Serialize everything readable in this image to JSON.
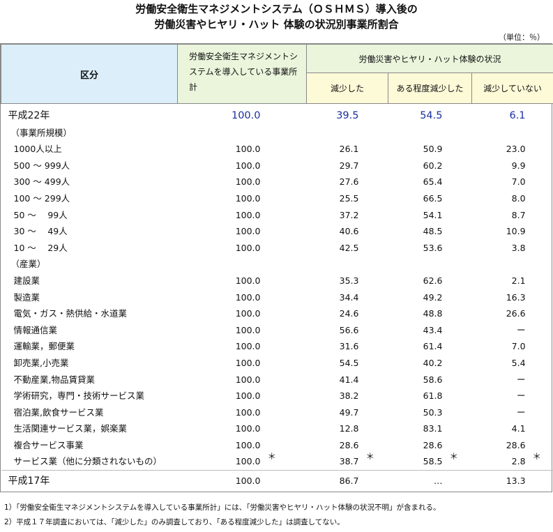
{
  "title": {
    "line1": "労働安全衛生マネジメントシステム（ＯＳＨＭＳ）導入後の",
    "line2": "労働災害やヒヤリ・ハット 体験の状況別事業所割合"
  },
  "unit": "（単位：％）",
  "header": {
    "kubun": "区分",
    "oshms": "労働安全衛生マネジメントシステムを導入している事業所計",
    "group": "労働災害やヒヤリ・ハット体験の状況",
    "sub": [
      "減少した",
      "ある程度減少した",
      "減少していない"
    ]
  },
  "rows": [
    {
      "label": "平成22年",
      "v": [
        "100.0",
        "39.5",
        "54.5",
        "6.1"
      ]
    },
    {
      "label": "（事業所規模）",
      "v": [
        "",
        "",
        "",
        ""
      ]
    },
    {
      "label": "1000人以上",
      "v": [
        "100.0",
        "26.1",
        "50.9",
        "23.0"
      ]
    },
    {
      "label": "500 ～ 999人",
      "v": [
        "100.0",
        "29.7",
        "60.2",
        "9.9"
      ]
    },
    {
      "label": "300 ～ 499人",
      "v": [
        "100.0",
        "27.6",
        "65.4",
        "7.0"
      ]
    },
    {
      "label": "100 ～ 299人",
      "v": [
        "100.0",
        "25.5",
        "66.5",
        "8.0"
      ]
    },
    {
      "label": "50 ～　 99人",
      "v": [
        "100.0",
        "37.2",
        "54.1",
        "8.7"
      ]
    },
    {
      "label": "30 ～　 49人",
      "v": [
        "100.0",
        "40.6",
        "48.5",
        "10.9"
      ]
    },
    {
      "label": "10 ～　 29人",
      "v": [
        "100.0",
        "42.5",
        "53.6",
        "3.8"
      ]
    },
    {
      "label": "（産業）",
      "v": [
        "",
        "",
        "",
        ""
      ]
    },
    {
      "label": "建設業",
      "v": [
        "100.0",
        "35.3",
        "62.6",
        "2.1"
      ]
    },
    {
      "label": "製造業",
      "v": [
        "100.0",
        "34.4",
        "49.2",
        "16.3"
      ]
    },
    {
      "label": "電気・ガス・熱供給・水道業",
      "v": [
        "100.0",
        "24.6",
        "48.8",
        "26.6"
      ]
    },
    {
      "label": "情報通信業",
      "v": [
        "100.0",
        "56.6",
        "43.4",
        "ー"
      ]
    },
    {
      "label": "運輸業，郵便業",
      "v": [
        "100.0",
        "31.6",
        "61.4",
        "7.0"
      ]
    },
    {
      "label": "卸売業,小売業",
      "v": [
        "100.0",
        "54.5",
        "40.2",
        "5.4"
      ]
    },
    {
      "label": "不動産業,物品賃貸業",
      "v": [
        "100.0",
        "41.4",
        "58.6",
        "ー"
      ]
    },
    {
      "label": "学術研究，専門・技術サービス業",
      "v": [
        "100.0",
        "38.2",
        "61.8",
        "ー"
      ]
    },
    {
      "label": "宿泊業,飲食サービス業",
      "v": [
        "100.0",
        "49.7",
        "50.3",
        "ー"
      ]
    },
    {
      "label": "生活関連サービス業，娯楽業",
      "v": [
        "100.0",
        "12.8",
        "83.1",
        "4.1"
      ]
    },
    {
      "label": "複合サービス事業",
      "v": [
        "100.0",
        "28.6",
        "28.6",
        "28.6"
      ],
      "star": "＊"
    },
    {
      "label": "サービス業（他に分類されないもの）",
      "v": [
        "100.0",
        "38.7",
        "58.5",
        "2.8"
      ]
    },
    {
      "label": "平成17年",
      "v": [
        "100.0",
        "86.7",
        "…",
        "13.3"
      ]
    }
  ],
  "notes": [
    "1）「労働安全衛生マネジメントシステムを導入している事業所計」には、「労働災害やヒヤリ・ハット体験の状況不明」が含まれる。",
    "2）平成１７年調査においては、「減少した」のみ調査しており、「ある程度減少した」は調査してない。"
  ]
}
